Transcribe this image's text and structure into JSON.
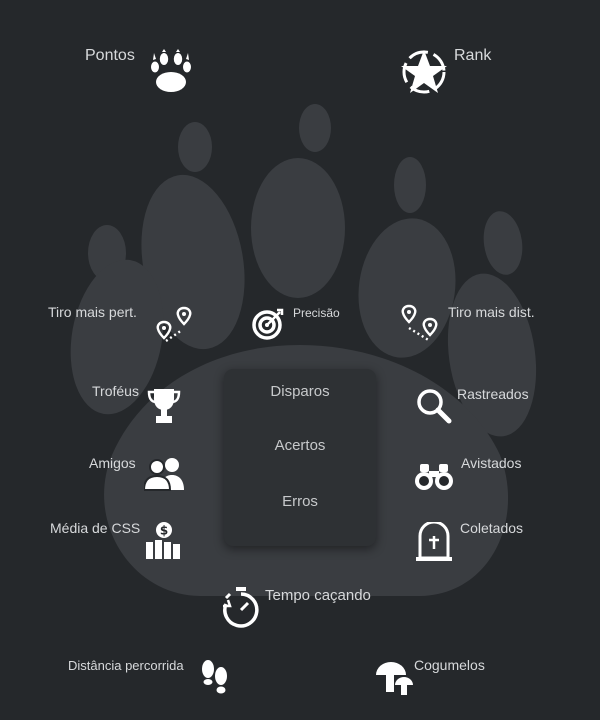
{
  "top": {
    "points_label": "Pontos",
    "rank_label": "Rank"
  },
  "stats": {
    "closest_shot": "Tiro mais pert.",
    "precision": "Precisão",
    "farthest_shot": "Tiro mais dist.",
    "trophies": "Troféus",
    "tracked": "Rastreados",
    "friends": "Amigos",
    "spotted": "Avistados",
    "average_css": "Média de CSS",
    "collected": "Coletados",
    "hunting_time": "Tempo caçando",
    "distance": "Distância percorrida",
    "mushrooms": "Cogumelos"
  },
  "panel": {
    "shots": "Disparos",
    "hits": "Acertos",
    "misses": "Erros"
  },
  "colors": {
    "background": "#25282b",
    "paw": "#3a3d41",
    "panel": "#2e3134",
    "icon": "#ffffff"
  },
  "icons": [
    "paw-icon",
    "star-badge-icon",
    "route-pins-icon",
    "target-icon",
    "trophy-icon",
    "magnifier-icon",
    "users-icon",
    "binoculars-icon",
    "money-chart-icon",
    "gravestone-icon",
    "stopwatch-icon",
    "footprints-icon",
    "mushroom-icon"
  ]
}
